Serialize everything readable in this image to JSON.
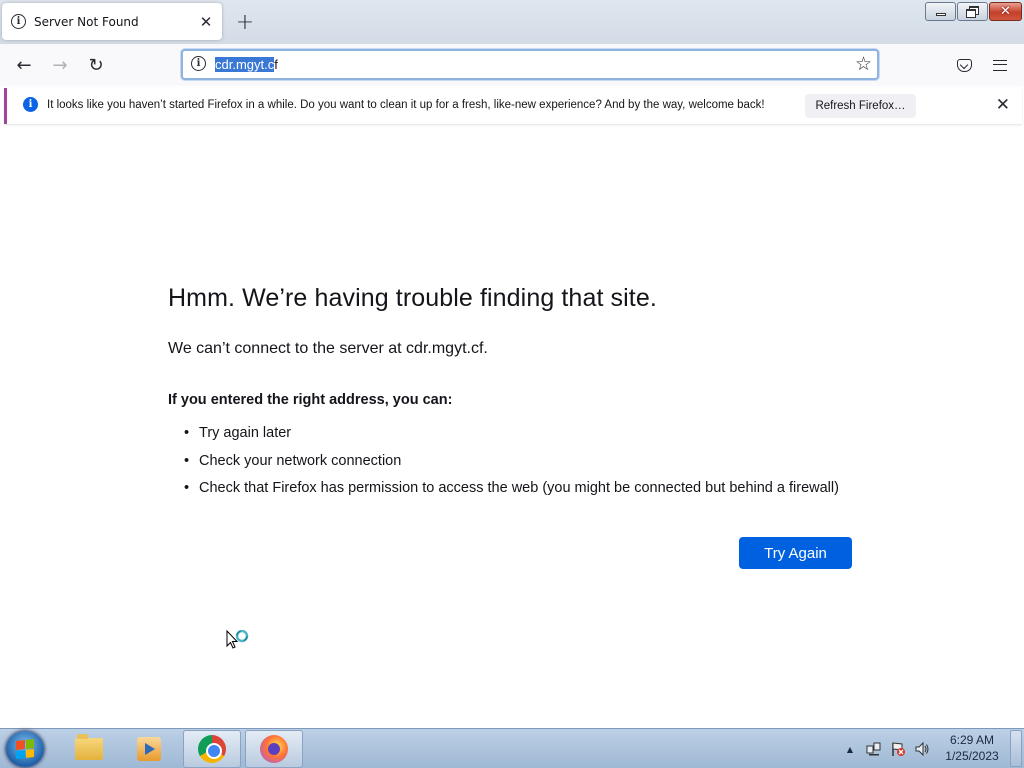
{
  "tab": {
    "title": "Server Not Found",
    "close_glyph": "✕",
    "new_tab_glyph": "+"
  },
  "window_controls": {
    "minimize": "minimize-icon",
    "maximize": "restore-icon",
    "close": "close-icon"
  },
  "navbar": {
    "back_glyph": "←",
    "forward_glyph": "→",
    "reload_glyph": "↻",
    "url_selected": "cdr.mgyt.c",
    "url_rest": "f",
    "star_glyph": "☆"
  },
  "notification": {
    "text": "It looks like you haven’t started Firefox in a while. Do you want to clean it up for a fresh, like-new experience? And by the way, welcome back!",
    "button_label": "Refresh Firefox…",
    "close_glyph": "✕",
    "accent_color": "#a0459b"
  },
  "error_page": {
    "title": "Hmm. We’re having trouble finding that site.",
    "short_desc": "We can’t connect to the server at cdr.mgyt.cf.",
    "suggestion_header": "If you entered the right address, you can:",
    "suggestions": [
      "Try again later",
      "Check your network connection",
      "Check that Firefox has permission to access the web (you might be connected but behind a firewall)"
    ],
    "try_again_label": "Try Again",
    "button_color": "#0061e0"
  },
  "taskbar": {
    "items": [
      "file-explorer-icon",
      "media-player-icon",
      "chrome-icon",
      "firefox-icon"
    ],
    "tray": {
      "up_arrow": "▲"
    },
    "clock_time": "6:29 AM",
    "clock_date": "1/25/2023"
  }
}
